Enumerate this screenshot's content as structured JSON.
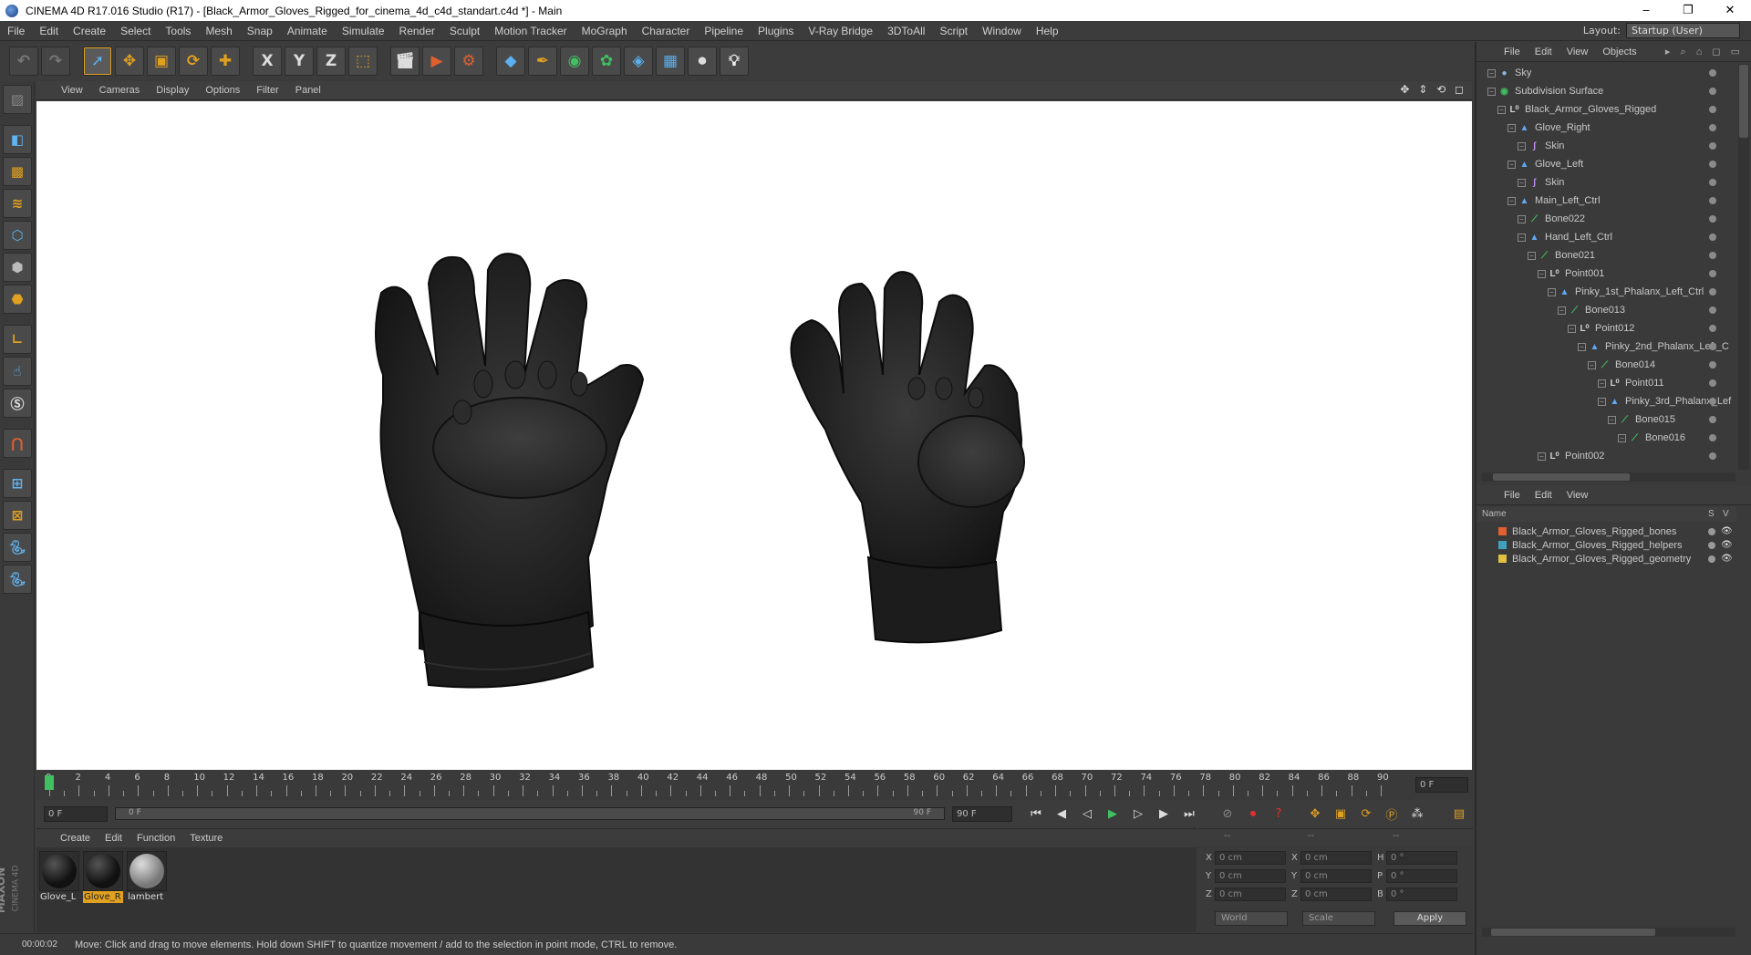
{
  "window": {
    "title": "CINEMA 4D R17.016 Studio (R17) - [Black_Armor_Gloves_Rigged_for_cinema_4d_c4d_standart.c4d *] - Main",
    "controls": [
      "–",
      "❐",
      "✕"
    ]
  },
  "menubar": {
    "items": [
      "File",
      "Edit",
      "Create",
      "Select",
      "Tools",
      "Mesh",
      "Snap",
      "Animate",
      "Simulate",
      "Render",
      "Sculpt",
      "Motion Tracker",
      "MoGraph",
      "Character",
      "Pipeline",
      "Plugins",
      "V-Ray Bridge",
      "3DToAll",
      "Script",
      "Window",
      "Help"
    ],
    "layout_label": "Layout:",
    "layout_value": "Startup (User)"
  },
  "toolbar": {
    "icons": [
      "undo-icon",
      "redo-icon",
      "live-selection-icon",
      "move-icon",
      "scale-icon",
      "rotate-icon",
      "add-icon",
      "x-axis-icon",
      "y-axis-icon",
      "z-axis-icon",
      "coord-system-icon",
      "render-view-icon",
      "render-picture-viewer-icon",
      "render-settings-icon",
      "cube-icon",
      "pen-icon",
      "subdivision-icon",
      "cloner-icon",
      "deformer-icon",
      "floor-icon",
      "camera-icon",
      "light-icon"
    ],
    "axis_labels": [
      "X",
      "Y",
      "Z"
    ]
  },
  "viewport": {
    "menu": [
      "View",
      "Cameras",
      "Display",
      "Options",
      "Filter",
      "Panel"
    ],
    "nav_icons": "✥ ⇕ ⟲ ◻"
  },
  "timeline": {
    "ticks": [
      "0",
      "2",
      "4",
      "6",
      "8",
      "10",
      "12",
      "14",
      "16",
      "18",
      "20",
      "22",
      "24",
      "26",
      "28",
      "30",
      "32",
      "34",
      "36",
      "38",
      "40",
      "42",
      "44",
      "46",
      "48",
      "50",
      "52",
      "54",
      "56",
      "58",
      "60",
      "62",
      "64",
      "66",
      "68",
      "70",
      "72",
      "74",
      "76",
      "78",
      "80",
      "82",
      "84",
      "86",
      "88",
      "90"
    ],
    "current_frame": "0 F",
    "start_frame": "0 F",
    "range_start": "0 F",
    "range_end": "90 F",
    "end_frame": "90 F"
  },
  "materials": {
    "menu": [
      "Create",
      "Edit",
      "Function",
      "Texture"
    ],
    "items": [
      {
        "name": "Glove_L",
        "color": "#1a1a1a",
        "selected": false
      },
      {
        "name": "Glove_R",
        "color": "#1a1a1a",
        "selected": true
      },
      {
        "name": "lambert",
        "color": "#9a9a9a",
        "selected": false
      }
    ],
    "brand_top": "MAXON",
    "brand_bottom": "CINEMA 4D"
  },
  "coordinates": {
    "header": [
      "--",
      "--",
      "--"
    ],
    "rows": [
      {
        "a": "X",
        "av": "0 cm",
        "b": "X",
        "bv": "0 cm",
        "c": "H",
        "cv": "0 °"
      },
      {
        "a": "Y",
        "av": "0 cm",
        "b": "Y",
        "bv": "0 cm",
        "c": "P",
        "cv": "0 °"
      },
      {
        "a": "Z",
        "av": "0 cm",
        "b": "Z",
        "bv": "0 cm",
        "c": "B",
        "cv": "0 °"
      }
    ],
    "mode": "World",
    "transform": "Scale",
    "apply": "Apply"
  },
  "status": {
    "time": "00:00:02",
    "message": "Move: Click and drag to move elements. Hold down SHIFT to quantize movement / add to the selection in point mode, CTRL to remove."
  },
  "object_manager": {
    "menu": [
      "File",
      "Edit",
      "View",
      "Objects"
    ],
    "items": [
      {
        "name": "Sky",
        "depth": 0,
        "icon": "sky-icon",
        "color": "#8fb8e0"
      },
      {
        "name": "Subdivision Surface",
        "depth": 0,
        "icon": "subdivision-icon",
        "color": "#40c060"
      },
      {
        "name": "Black_Armor_Gloves_Rigged",
        "depth": 1,
        "icon": "null-icon",
        "color": "#d0d0d0"
      },
      {
        "name": "Glove_Right",
        "depth": 2,
        "icon": "polygon-icon",
        "color": "#60a8f0"
      },
      {
        "name": "Skin",
        "depth": 3,
        "icon": "skin-icon",
        "color": "#c090f0"
      },
      {
        "name": "Glove_Left",
        "depth": 2,
        "icon": "polygon-icon",
        "color": "#60a8f0"
      },
      {
        "name": "Skin",
        "depth": 3,
        "icon": "skin-icon",
        "color": "#c090f0"
      },
      {
        "name": "Main_Left_Ctrl",
        "depth": 2,
        "icon": "polygon-icon",
        "color": "#60a8f0"
      },
      {
        "name": "Bone022",
        "depth": 3,
        "icon": "bone-icon",
        "color": "#40c060"
      },
      {
        "name": "Hand_Left_Ctrl",
        "depth": 3,
        "icon": "polygon-icon",
        "color": "#60a8f0"
      },
      {
        "name": "Bone021",
        "depth": 4,
        "icon": "bone-icon",
        "color": "#40c060"
      },
      {
        "name": "Point001",
        "depth": 5,
        "icon": "null-icon",
        "color": "#d0d0d0"
      },
      {
        "name": "Pinky_1st_Phalanx_Left_Ctrl",
        "depth": 6,
        "icon": "polygon-icon",
        "color": "#60a8f0"
      },
      {
        "name": "Bone013",
        "depth": 7,
        "icon": "bone-icon",
        "color": "#40c060"
      },
      {
        "name": "Point012",
        "depth": 8,
        "icon": "null-icon",
        "color": "#d0d0d0"
      },
      {
        "name": "Pinky_2nd_Phalanx_Left_C",
        "depth": 9,
        "icon": "polygon-icon",
        "color": "#60a8f0"
      },
      {
        "name": "Bone014",
        "depth": 10,
        "icon": "bone-icon",
        "color": "#40c060"
      },
      {
        "name": "Point011",
        "depth": 11,
        "icon": "null-icon",
        "color": "#d0d0d0"
      },
      {
        "name": "Pinky_3rd_Phalanx_Lef",
        "depth": 11,
        "icon": "polygon-icon",
        "color": "#60a8f0"
      },
      {
        "name": "Bone015",
        "depth": 12,
        "icon": "bone-icon",
        "color": "#40c060"
      },
      {
        "name": "Bone016",
        "depth": 13,
        "icon": "bone-icon",
        "color": "#40c060"
      },
      {
        "name": "Point002",
        "depth": 5,
        "icon": "null-icon",
        "color": "#d0d0d0"
      }
    ]
  },
  "layer_manager": {
    "menu": [
      "File",
      "Edit",
      "View"
    ],
    "columns": {
      "name": "Name",
      "s": "S",
      "v": "V"
    },
    "layers": [
      {
        "name": "Black_Armor_Gloves_Rigged_bones",
        "color": "#e06030"
      },
      {
        "name": "Black_Armor_Gloves_Rigged_helpers",
        "color": "#40a0c0"
      },
      {
        "name": "Black_Armor_Gloves_Rigged_geometry",
        "color": "#e0c040"
      }
    ]
  }
}
